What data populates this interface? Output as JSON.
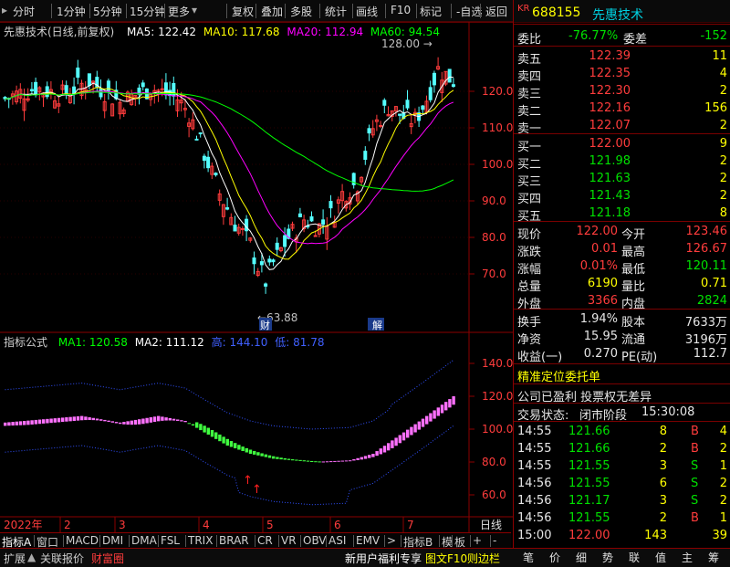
{
  "toolbar": {
    "items": [
      "分时",
      "1分钟",
      "5分钟",
      "15分钟",
      "更多",
      "复权",
      "叠加",
      "多股",
      "统计",
      "画线",
      "F10",
      "标记",
      "-自选",
      "返回"
    ],
    "arrow": "▾"
  },
  "stock": {
    "market": "KR",
    "code": "688155",
    "name": "先惠技术"
  },
  "main_title": {
    "name": "先惠技术(日线,前复权)",
    "ma5": "MA5: 122.42",
    "ma10": "MA10: 117.68",
    "ma20": "MA20: 112.94",
    "ma60": "MA60: 94.54"
  },
  "annotations": {
    "high": "128.00",
    "low": "63.88",
    "fin": "财",
    "jie": "解"
  },
  "sub_title": {
    "name": "指标公式",
    "ma1": "MA1: 120.58",
    "ma2": "MA2: 111.12",
    "m3": "高: 144.10",
    "m4": "低: 81.78"
  },
  "colors": {
    "ma5": "#ffffff",
    "ma10": "#ffff00",
    "ma20": "#ff00ff",
    "ma60": "#00ff00",
    "up": "#ff3c3c",
    "down": "#54ffff"
  },
  "chart_data": [
    {
      "type": "candlestick",
      "title": "先惠技术(日线,前复权)",
      "ylim": [
        60,
        135
      ],
      "yticks": [
        "120.0",
        "110.0",
        "100.0",
        "90.0",
        "80.0",
        "70.0"
      ],
      "series": [
        {
          "name": "MA5",
          "value": 122.42
        },
        {
          "name": "MA10",
          "value": 117.68
        },
        {
          "name": "MA20",
          "value": 112.94
        },
        {
          "name": "MA60",
          "value": 94.54
        }
      ],
      "max_label": 128.0,
      "min_label": 63.88
    },
    {
      "type": "area",
      "title": "指标公式",
      "ylim": [
        50,
        150
      ],
      "yticks": [
        "140.0",
        "120.0",
        "100.0",
        "80.0",
        "60.0"
      ],
      "series": [
        {
          "name": "MA1",
          "value": 120.58
        },
        {
          "name": "MA2",
          "value": 111.12
        },
        {
          "name": "高",
          "value": 144.1
        },
        {
          "name": "低",
          "value": 81.78
        }
      ]
    }
  ],
  "x_axis": {
    "labels": [
      "2022年",
      "2",
      "3",
      "4",
      "5",
      "6",
      "7"
    ],
    "right_label": "日线"
  },
  "orderbook": {
    "wb_label": "委比",
    "wb_value": "-76.77%",
    "wc_label": "委差",
    "wc_value": "-152",
    "sell": [
      {
        "label": "卖五",
        "price": "122.39",
        "vol": "11"
      },
      {
        "label": "卖四",
        "price": "122.35",
        "vol": "4"
      },
      {
        "label": "卖三",
        "price": "122.30",
        "vol": "2"
      },
      {
        "label": "卖二",
        "price": "122.16",
        "vol": "156"
      },
      {
        "label": "卖一",
        "price": "122.07",
        "vol": "2"
      }
    ],
    "buy": [
      {
        "label": "买一",
        "price": "122.00",
        "vol": "9"
      },
      {
        "label": "买二",
        "price": "121.98",
        "vol": "2"
      },
      {
        "label": "买三",
        "price": "121.63",
        "vol": "2"
      },
      {
        "label": "买四",
        "price": "121.43",
        "vol": "2"
      },
      {
        "label": "买五",
        "price": "121.18",
        "vol": "8"
      }
    ]
  },
  "quote": [
    {
      "l1": "现价",
      "v1": "122.00",
      "c1": "red",
      "l2": "今开",
      "v2": "123.46",
      "c2": "red"
    },
    {
      "l1": "涨跌",
      "v1": "0.01",
      "c1": "red",
      "l2": "最高",
      "v2": "126.67",
      "c2": "red"
    },
    {
      "l1": "涨幅",
      "v1": "0.01%",
      "c1": "red",
      "l2": "最低",
      "v2": "120.11",
      "c2": "grn"
    },
    {
      "l1": "总量",
      "v1": "6190",
      "c1": "yel",
      "l2": "量比",
      "v2": "0.71",
      "c2": "yel"
    },
    {
      "l1": "外盘",
      "v1": "3366",
      "c1": "red",
      "l2": "内盘",
      "v2": "2824",
      "c2": "grn"
    }
  ],
  "stats": [
    {
      "l1": "换手",
      "v1": "1.94%",
      "l2": "股本",
      "v2": "7633万"
    },
    {
      "l1": "净资",
      "v1": "15.95",
      "l2": "流通",
      "v2": "3196万"
    },
    {
      "l1": "收益(一)",
      "v1": "0.270",
      "l2": "PE(动)",
      "v2": "112.7"
    }
  ],
  "notices": {
    "line1": "精准定位委托单",
    "line2": "公司已盈利 投票权无差异",
    "status_label": "交易状态:",
    "status_value": "闭市阶段",
    "status_time": "15:30:08"
  },
  "trades": [
    {
      "time": "14:55",
      "price": "121.66",
      "vol": "8",
      "bs": "B",
      "n": "4"
    },
    {
      "time": "14:55",
      "price": "121.66",
      "vol": "2",
      "bs": "B",
      "n": "2"
    },
    {
      "time": "14:55",
      "price": "121.55",
      "vol": "3",
      "bs": "S",
      "n": "1"
    },
    {
      "time": "14:56",
      "price": "121.55",
      "vol": "6",
      "bs": "S",
      "n": "2"
    },
    {
      "time": "14:56",
      "price": "121.17",
      "vol": "3",
      "bs": "S",
      "n": "2"
    },
    {
      "time": "14:56",
      "price": "121.55",
      "vol": "2",
      "bs": "B",
      "n": "1"
    },
    {
      "time": "15:00",
      "price": "122.00",
      "vol": "143",
      "bs": "",
      "n": "39"
    }
  ],
  "indicator_tabs": [
    "指标A",
    "窗口",
    "MACD",
    "DMI",
    "DMA",
    "FSL",
    "TRIX",
    "BRAR",
    "CR",
    "VR",
    "OBV",
    "ASI",
    "EMV",
    ">",
    "指标B",
    "模",
    "板",
    "+",
    "-"
  ],
  "bottom_left": [
    "扩展",
    "关联报价",
    "财富圈"
  ],
  "bottom_mid": [
    "新用户福利专享",
    "图文F10",
    "则边栏"
  ],
  "bottom_right": [
    "笔",
    "价",
    "细",
    "势",
    "联",
    "值",
    "主",
    "筹"
  ]
}
